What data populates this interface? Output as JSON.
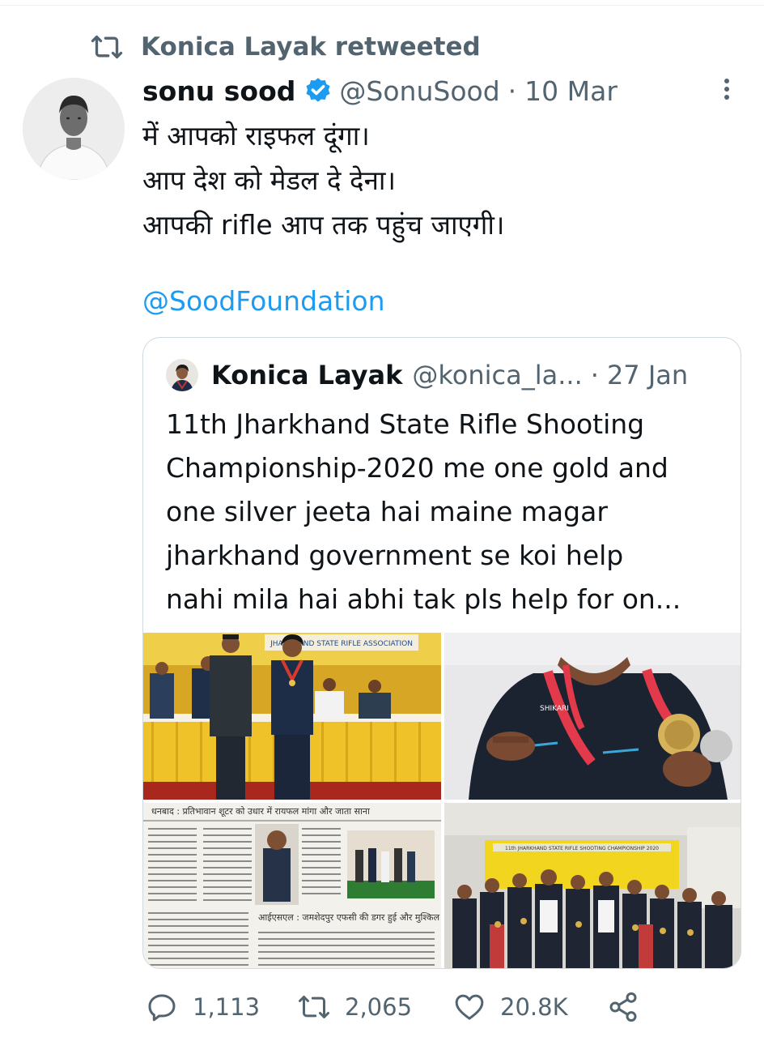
{
  "retweet_banner": {
    "icon": "retweet-icon",
    "text": "Konica Layak retweeted"
  },
  "tweet": {
    "author_name": "sonu sood",
    "verified": true,
    "handle": "@SonuSood",
    "separator": "·",
    "date": "10 Mar",
    "text_lines": [
      "में आपको राइफल दूंगा।",
      "आप देश को मेडल दे देना।",
      "आपकी rifle आप तक पहुंच जाएगी।"
    ],
    "mention": "@SoodFoundation"
  },
  "quoted_tweet": {
    "author_name": "Konica Layak",
    "handle": "@konica_la...",
    "separator": "·",
    "date": "27 Jan",
    "text_lines": [
      "11th Jharkhand State Rifle Shooting",
      "Championship-2020 me one gold and",
      "one silver jeeta hai maine magar",
      "jharkhand government se koi help",
      "nahi mila hai abhi tak pls help for on..."
    ],
    "media": [
      {
        "name": "award-ceremony-photo",
        "banner_text": "JHARKHAND STATE RIFLE ASSOCIATION"
      },
      {
        "name": "gold-medal-photo",
        "jacket_text": "SHIKARI"
      },
      {
        "name": "newspaper-clipping-photo",
        "headline": "धनबाद : प्रतिभावान शूटर को उधार में रायफल मांगा और जाता साना",
        "subheadline": "आईएसएल : जमशेदपुर एफसी की डगर हुई और मुश्किल"
      },
      {
        "name": "group-photo",
        "banner_text": "11th JHARKHAND STATE RIFLE SHOOTING CHAMPIONSHIP 2020"
      }
    ]
  },
  "actions": {
    "replies": "1,113",
    "retweets": "2,065",
    "likes": "20.8K",
    "share_icon": "share-icon"
  },
  "colors": {
    "link": "#1d9bf0",
    "verified": "#1d9bf0",
    "secondary_text": "#536471",
    "primary_text": "#0f1419",
    "border": "#cfd9de"
  }
}
